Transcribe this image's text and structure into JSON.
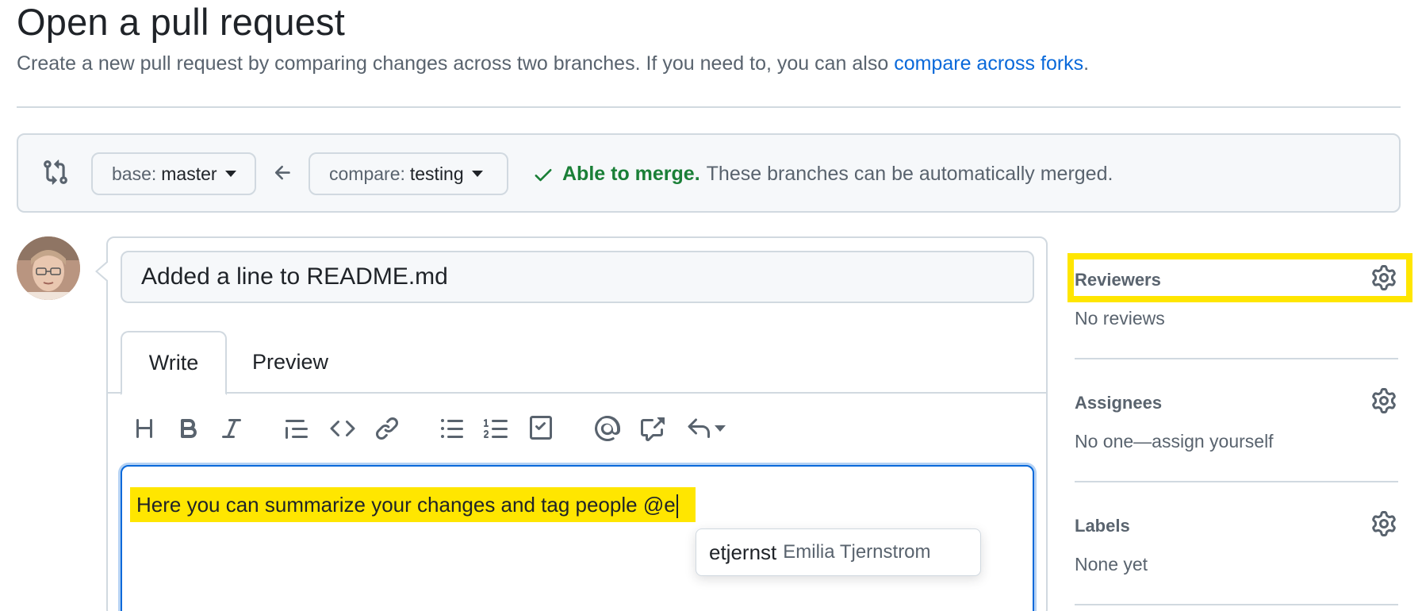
{
  "header": {
    "title": "Open a pull request",
    "subtitle_text": "Create a new pull request by comparing changes across two branches. If you need to, you can also",
    "subtitle_link": "compare across forks",
    "subtitle_end": "."
  },
  "compare_bar": {
    "base_label": "base:",
    "base_branch": "master",
    "compare_label": "compare:",
    "compare_branch": "testing",
    "merge_status_bold": "Able to merge.",
    "merge_status_text": "These branches can be automatically merged."
  },
  "form": {
    "title_value": "Added a line to README.md",
    "tabs": [
      {
        "label": "Write",
        "selected": true
      },
      {
        "label": "Preview",
        "selected": false
      }
    ],
    "toolbar_icons": [
      "heading-icon",
      "bold-icon",
      "italic-icon",
      "quote-icon",
      "code-icon",
      "link-icon",
      "unordered-list-icon",
      "ordered-list-icon",
      "task-list-icon",
      "mention-icon",
      "cross-reference-icon",
      "reply-icon"
    ],
    "editor_text": "Here you can summarize your changes and tag people @e",
    "mention_suggestion": {
      "login": "etjernst",
      "full_name": "Emilia Tjernstrom"
    }
  },
  "sidebar": {
    "reviewers": {
      "heading": "Reviewers",
      "value": "No reviews"
    },
    "assignees": {
      "heading": "Assignees",
      "value": "No one—assign yourself"
    },
    "labels": {
      "heading": "Labels",
      "value": "None yet"
    }
  },
  "colors": {
    "highlight": "#ffe600",
    "link": "#0969da",
    "success": "#1a7f37"
  }
}
